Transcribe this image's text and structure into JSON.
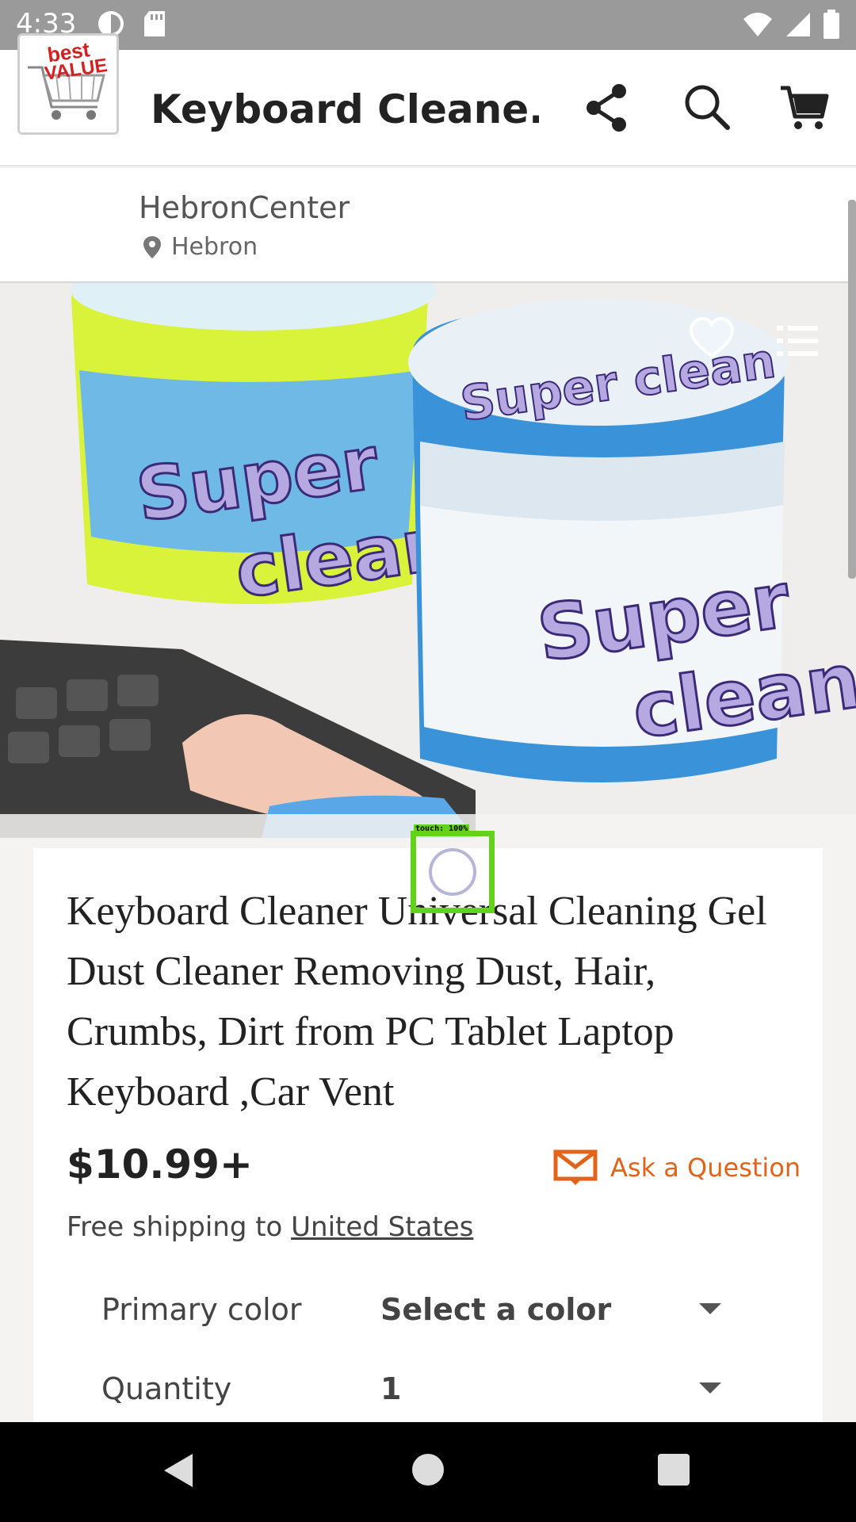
{
  "status_bar": {
    "time": "4:33"
  },
  "app_bar": {
    "title": "Keyboard Cleane..."
  },
  "shop": {
    "name": "HebronCenter",
    "location": "Hebron",
    "logo_text": "best VALUE"
  },
  "product": {
    "title": "Keyboard Cleaner Universal Cleaning Gel Dust Cleaner Removing Dust, Hair, Crumbs, Dirt from PC Tablet Laptop Keyboard ,Car Vent",
    "price": "$10.99+",
    "ask_label": "Ask a Question",
    "shipping_prefix": "Free shipping to ",
    "shipping_country": "United States",
    "image_texts": {
      "jar_left": "Super clean",
      "jar_right": "Super clean"
    }
  },
  "options": [
    {
      "label": "Primary color",
      "value": "Select a color"
    },
    {
      "label": "Quantity",
      "value": "1"
    }
  ],
  "touch_overlay": {
    "label": "touch: 100%"
  },
  "colors": {
    "accent": "#e2631a",
    "touch": "#62d21b",
    "statusbar": "#9a9a9a"
  }
}
